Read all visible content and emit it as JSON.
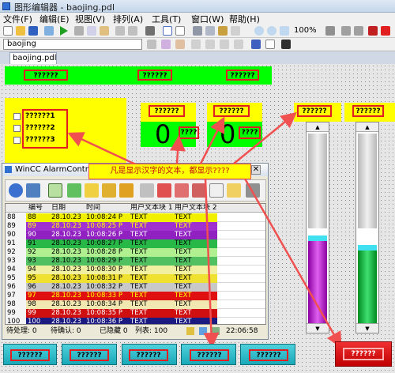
{
  "window": {
    "title": "图形编辑器 - baojing.pdl"
  },
  "menu": [
    "文件(F)",
    "编辑(E)",
    "视图(V)",
    "排列(A)",
    "工具(T)",
    "窗口(W)",
    "帮助(H)"
  ],
  "toolbar": {
    "zoom": "100%",
    "font_select": "baojing"
  },
  "tab": {
    "label": "baojing.pdl"
  },
  "canvas": {
    "top_bar_labels": [
      "??????",
      "??????",
      "??????"
    ],
    "checkbox_labels": [
      "??????1",
      "??????2",
      "??????3"
    ],
    "io_labels": [
      "??????",
      "??????"
    ],
    "io_values": [
      "0",
      "0"
    ],
    "io_units": [
      "????",
      "????"
    ],
    "slider_labels": [
      "??????",
      "??????"
    ],
    "slider_levels": [
      0.45,
      0.4
    ],
    "annotation": "凡是显示汉字的文本，都显示????",
    "bottom_buttons": [
      "??????",
      "??????",
      "??????",
      "??????",
      "??????"
    ],
    "red_button": "??????"
  },
  "alarm": {
    "title": "WinCC AlarmControl",
    "headers": [
      "编号",
      "日期",
      "时间",
      "用户文本块 1",
      "用户文本块 2"
    ],
    "rows": [
      {
        "num": "88",
        "id": "88",
        "date": "28.10.23",
        "time": "10:08:24 P",
        "t1": "TEXT",
        "t2": "TEXT"
      },
      {
        "num": "89",
        "id": "89",
        "date": "28.10.23",
        "time": "10:08:25 P",
        "t1": "TEXT",
        "t2": "TEXT"
      },
      {
        "num": "90",
        "id": "90",
        "date": "28.10.23",
        "time": "10:08:26 P",
        "t1": "TEXT",
        "t2": "TEXT"
      },
      {
        "num": "91",
        "id": "91",
        "date": "28.10.23",
        "time": "10:08:27 P",
        "t1": "TEXT",
        "t2": "TEXT"
      },
      {
        "num": "92",
        "id": "92",
        "date": "28.10.23",
        "time": "10:08:28 P",
        "t1": "TEXT",
        "t2": "TEXT"
      },
      {
        "num": "93",
        "id": "93",
        "date": "28.10.23",
        "time": "10:08:29 P",
        "t1": "TEXT",
        "t2": "TEXT"
      },
      {
        "num": "94",
        "id": "94",
        "date": "28.10.23",
        "time": "10:08:30 P",
        "t1": "TEXT",
        "t2": "TEXT"
      },
      {
        "num": "95",
        "id": "95",
        "date": "28.10.23",
        "time": "10:08:31 P",
        "t1": "TEXT",
        "t2": "TEXT"
      },
      {
        "num": "96",
        "id": "96",
        "date": "28.10.23",
        "time": "10:08:32 P",
        "t1": "TEXT",
        "t2": "TEXT"
      },
      {
        "num": "97",
        "id": "97",
        "date": "28.10.23",
        "time": "10:08:33 P",
        "t1": "TEXT",
        "t2": "TEXT"
      },
      {
        "num": "98",
        "id": "98",
        "date": "28.10.23",
        "time": "10:08:34 P",
        "t1": "TEXT",
        "t2": "TEXT"
      },
      {
        "num": "99",
        "id": "99",
        "date": "28.10.23",
        "time": "10:08:35 P",
        "t1": "TEXT",
        "t2": "TEXT"
      },
      {
        "num": "100",
        "id": "100",
        "date": "28.10.23",
        "time": "10:08:36 P",
        "t1": "TEXT",
        "t2": "TEXT"
      }
    ],
    "row_colors": [
      {
        "bg": "#f0f000",
        "fg": "#000000"
      },
      {
        "bg": "#a030d0",
        "fg": "#ffff00"
      },
      {
        "bg": "#9020c0",
        "fg": "#ffffff"
      },
      {
        "bg": "#28b848",
        "fg": "#000000"
      },
      {
        "bg": "#b0f090",
        "fg": "#000000"
      },
      {
        "bg": "#50c060",
        "fg": "#000000"
      },
      {
        "bg": "#f0f0a0",
        "fg": "#000000"
      },
      {
        "bg": "#f0e030",
        "fg": "#000000"
      },
      {
        "bg": "#c8c8c8",
        "fg": "#000000"
      },
      {
        "bg": "#e01010",
        "fg": "#ffff00"
      },
      {
        "bg": "#f0e8b0",
        "fg": "#000000"
      },
      {
        "bg": "#d01010",
        "fg": "#ffffff"
      },
      {
        "bg": "#1a1a80",
        "fg": "#ffffff"
      }
    ],
    "status": {
      "pending": "待处理: 0",
      "ack": "待确认: 0",
      "hidden": "已隐藏 0",
      "list": "列表: 100",
      "clock": "22:06:58"
    }
  }
}
